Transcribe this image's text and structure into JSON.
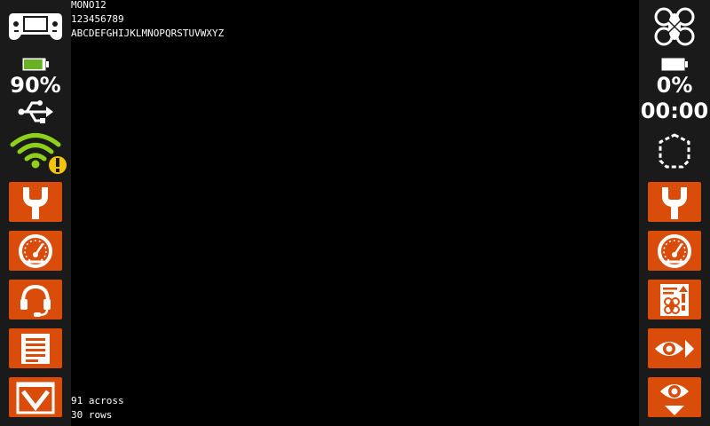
{
  "console": {
    "font_name": "MONO12",
    "digits": "123456789",
    "alphabet": "ABCDEFGHIJKLMNOPQRSTUVWXYZ",
    "across": "91 across",
    "rows": "30 rows"
  },
  "left_sidebar": {
    "device_icon": "handheld-controller-icon",
    "battery_percent": "90%",
    "battery_level": 0.9,
    "usb_icon": "usb-icon",
    "wifi_icon": "wifi-warning-icon",
    "buttons": [
      {
        "icon": "wrench-icon"
      },
      {
        "icon": "gauge-icon"
      },
      {
        "icon": "headset-icon"
      },
      {
        "icon": "document-list-icon"
      },
      {
        "icon": "chevron-down-icon"
      }
    ]
  },
  "right_sidebar": {
    "vehicle_icon": "drone-icon",
    "battery_percent": "0%",
    "battery_level": 0.0,
    "flight_time": "00:00",
    "shape_icon": "dashed-polygon-icon",
    "buttons": [
      {
        "icon": "wrench-icon"
      },
      {
        "icon": "gauge-icon"
      },
      {
        "icon": "drone-log-icon"
      },
      {
        "icon": "eye-forward-icon"
      },
      {
        "icon": "eye-down-icon"
      }
    ]
  },
  "colors": {
    "accent": "#d94c0a",
    "battery_green": "#6ab023",
    "wifi_green": "#8fd11a",
    "warning_yellow": "#f5c400",
    "sidebar_bg": "#1a1a1a",
    "console_bg": "#000000"
  }
}
